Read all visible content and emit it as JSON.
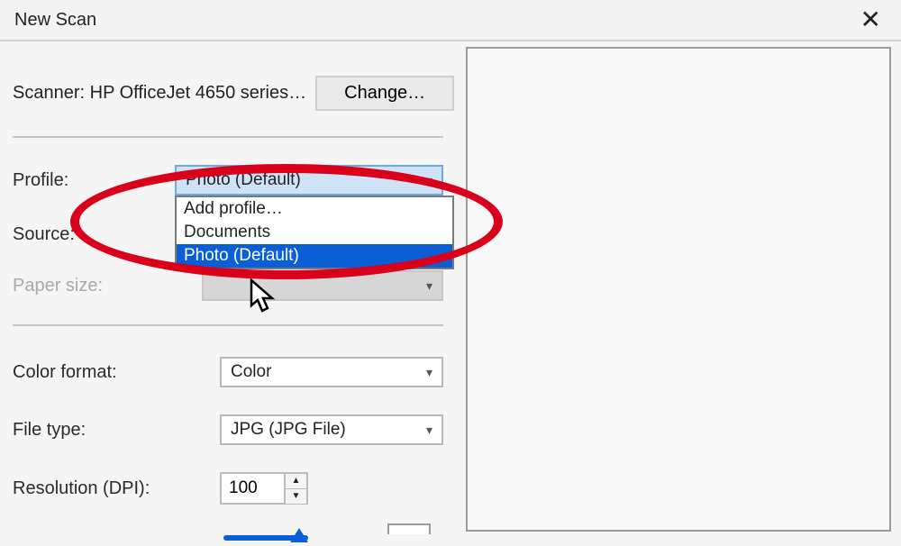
{
  "window": {
    "title": "New Scan",
    "close_icon": "✕"
  },
  "scanner": {
    "label_prefix": "Scanner:",
    "device": "HP OfficeJet 4650 series…",
    "change_btn": "Change…"
  },
  "profile": {
    "label": "Profile:",
    "selected": "Photo (Default)",
    "dropdown": {
      "items": [
        "Add profile…",
        "Documents",
        "Photo (Default)"
      ],
      "highlighted_index": 2
    }
  },
  "source": {
    "label": "Source:",
    "value": ""
  },
  "paper_size": {
    "label": "Paper size:",
    "value": "",
    "disabled": true
  },
  "color_format": {
    "label": "Color format:",
    "value": "Color"
  },
  "file_type": {
    "label": "File type:",
    "value": "JPG (JPG File)"
  },
  "resolution": {
    "label": "Resolution (DPI):",
    "value": "100"
  },
  "annotation": {
    "kind": "red-ellipse-highlight",
    "target": "profile-dropdown"
  }
}
